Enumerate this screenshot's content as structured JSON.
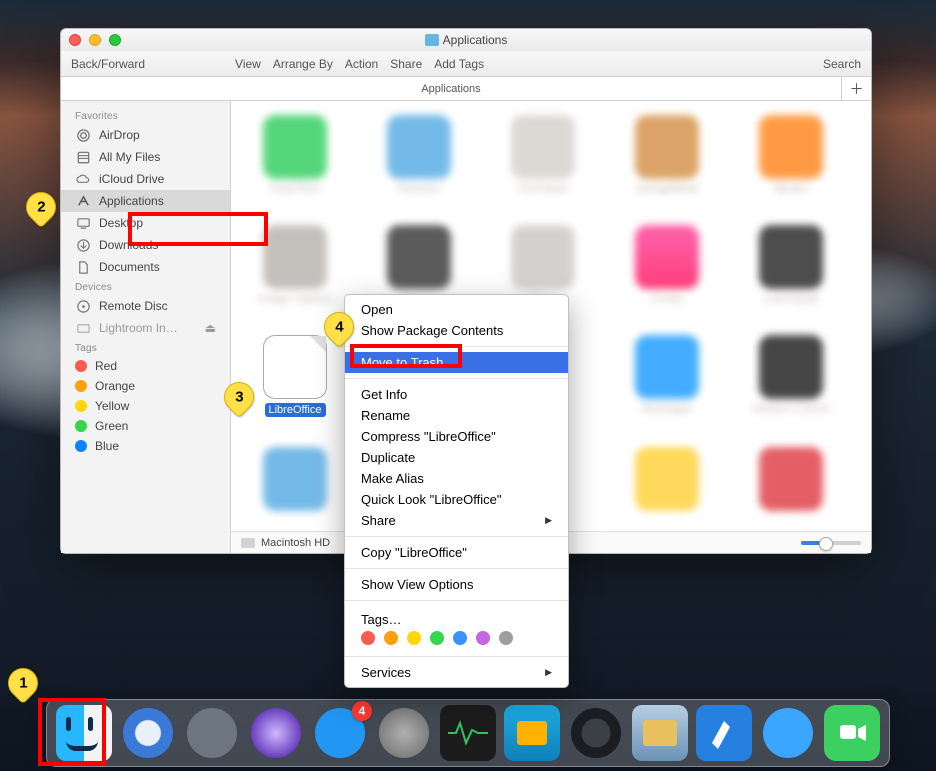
{
  "window": {
    "title": "Applications"
  },
  "toolbar": {
    "back_forward": "Back/Forward",
    "view": "View",
    "arrange_by": "Arrange By",
    "action": "Action",
    "share": "Share",
    "add_tags": "Add Tags",
    "search": "Search"
  },
  "tab": {
    "title": "Applications"
  },
  "sidebar": {
    "favorites_heading": "Favorites",
    "favorites": [
      {
        "label": "AirDrop",
        "icon": "airdrop"
      },
      {
        "label": "All My Files",
        "icon": "all-files"
      },
      {
        "label": "iCloud Drive",
        "icon": "icloud"
      },
      {
        "label": "Applications",
        "icon": "applications",
        "active": true
      },
      {
        "label": "Desktop",
        "icon": "desktop"
      },
      {
        "label": "Downloads",
        "icon": "downloads"
      },
      {
        "label": "Documents",
        "icon": "documents"
      }
    ],
    "devices_heading": "Devices",
    "devices": [
      {
        "label": "Remote Disc",
        "icon": "remote-disc"
      },
      {
        "label": "Lightroom In…",
        "icon": "disk-image"
      }
    ],
    "tags_heading": "Tags",
    "tags": [
      {
        "label": "Red",
        "color": "#ff5a52"
      },
      {
        "label": "Orange",
        "color": "#ff9f0a"
      },
      {
        "label": "Yellow",
        "color": "#ffd60a"
      },
      {
        "label": "Green",
        "color": "#32d74b"
      },
      {
        "label": "Blue",
        "color": "#0a84ff"
      }
    ]
  },
  "apps_row1": [
    "FaceTime",
    "Faronics",
    "Font Book",
    "GarageBand",
    "iBooks"
  ],
  "apps_row2": [
    "Image Capture",
    "iMovie",
    "iPhoto",
    "iTunes",
    "Launchpad"
  ],
  "apps_row3": [
    "LibreOffice",
    "",
    "",
    "Messages",
    "Mission Control"
  ],
  "selected_app": {
    "label": "LibreOffice"
  },
  "pathbar": {
    "disk": "Macintosh HD"
  },
  "context_menu": {
    "open": "Open",
    "show_package_contents": "Show Package Contents",
    "move_to_trash": "Move to Trash",
    "get_info": "Get Info",
    "rename": "Rename",
    "compress": "Compress \"LibreOffice\"",
    "duplicate": "Duplicate",
    "make_alias": "Make Alias",
    "quick_look": "Quick Look \"LibreOffice\"",
    "share": "Share",
    "copy": "Copy \"LibreOffice\"",
    "show_view_options": "Show View Options",
    "tags": "Tags…",
    "tag_colors": [
      "#ff5a52",
      "#ff9f0a",
      "#ffd60a",
      "#32d74b",
      "#3a91ff",
      "#c266e6",
      "#9e9e9e"
    ],
    "services": "Services"
  },
  "legends": {
    "one": "1",
    "two": "2",
    "three": "3",
    "four": "4"
  },
  "dock": {
    "items": [
      "Finder",
      "Safari",
      "Launchpad",
      "Siri",
      "App Store",
      "System Preferences",
      "Activity Monitor",
      "Display",
      "QuickTime",
      "Photos",
      "Xcode",
      "Messages",
      "FaceTime"
    ],
    "appstore_badge": "4"
  }
}
